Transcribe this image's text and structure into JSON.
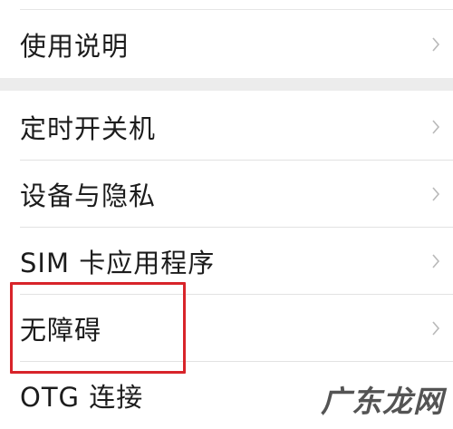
{
  "settings": {
    "top_items": [
      {
        "label": "使用说明"
      }
    ],
    "items": [
      {
        "label": "定时开关机"
      },
      {
        "label": "设备与隐私"
      },
      {
        "label": "SIM 卡应用程序"
      },
      {
        "label": "无障碍"
      },
      {
        "label": "OTG 连接"
      }
    ]
  },
  "highlight_color": "#d8242a",
  "watermark": "广东龙网",
  "icons": {
    "chevron": "chevron-right-icon"
  }
}
